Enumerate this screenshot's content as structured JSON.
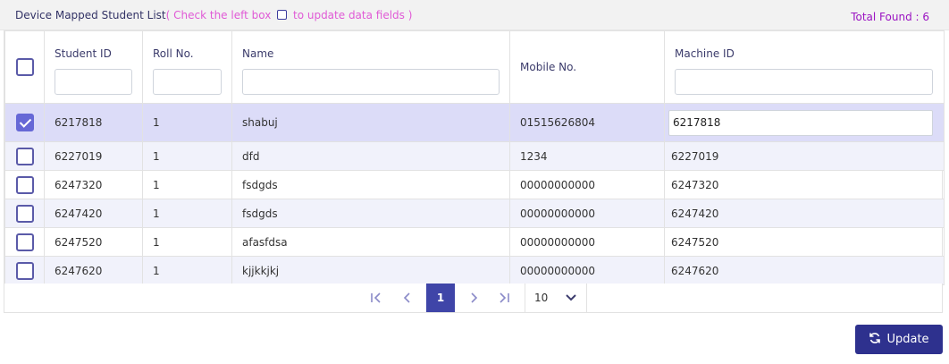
{
  "header": {
    "title": "Device Mapped Student List",
    "hint_before": "( Check the left box",
    "hint_after": "to update data fields )",
    "total_found": "Total Found : 6"
  },
  "columns": {
    "student_id": "Student ID",
    "roll_no": "Roll No.",
    "name": "Name",
    "mobile_no": "Mobile No.",
    "machine_id": "Machine ID"
  },
  "rows": [
    {
      "checked": true,
      "student_id": "6217818",
      "roll_no": "1",
      "name": "shabuj",
      "mobile_no": "01515626804",
      "machine_id": "6217818"
    },
    {
      "checked": false,
      "student_id": "6227019",
      "roll_no": "1",
      "name": "dfd",
      "mobile_no": "1234",
      "machine_id": "6227019"
    },
    {
      "checked": false,
      "student_id": "6247320",
      "roll_no": "1",
      "name": "fsdgds",
      "mobile_no": "00000000000",
      "machine_id": "6247320"
    },
    {
      "checked": false,
      "student_id": "6247420",
      "roll_no": "1",
      "name": "fsdgds",
      "mobile_no": "00000000000",
      "machine_id": "6247420"
    },
    {
      "checked": false,
      "student_id": "6247520",
      "roll_no": "1",
      "name": "afasfdsa",
      "mobile_no": "00000000000",
      "machine_id": "6247520"
    },
    {
      "checked": false,
      "student_id": "6247620",
      "roll_no": "1",
      "name": "kjjkkjkj",
      "mobile_no": "00000000000",
      "machine_id": "6247620"
    }
  ],
  "paginator": {
    "current_page": "1",
    "rows_per_page": "10"
  },
  "actions": {
    "update_label": "Update"
  },
  "colors": {
    "accent": "#3f45a8",
    "selected_row": "#dcdcf8",
    "hint_text": "#e05ad6",
    "total_found": "#9b14c2"
  }
}
